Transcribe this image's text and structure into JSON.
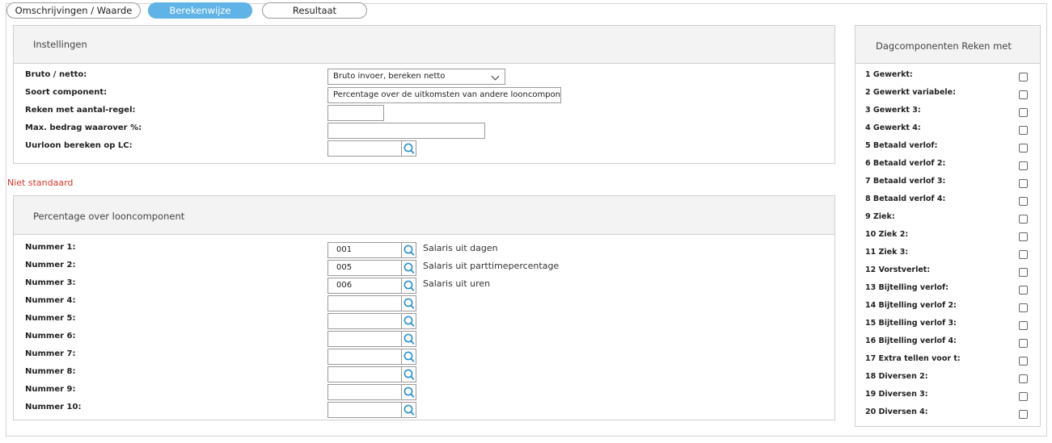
{
  "tabs": [
    {
      "label": "Omschrijvingen / Waarde",
      "active": false
    },
    {
      "label": "Berekenwijze",
      "active": true
    },
    {
      "label": "Resultaat",
      "active": false
    }
  ],
  "instellingen": {
    "title": "Instellingen",
    "bruto_netto_label": "Bruto / netto:",
    "bruto_netto_value": "Bruto invoer, bereken netto",
    "soort_label": "Soort component:",
    "soort_value": "Percentage over de uitkomsten van andere looncomponenten",
    "reken_label": "Reken met aantal-regel:",
    "reken_value": "",
    "max_label": "Max. bedrag waarover %:",
    "max_value": "",
    "uurloon_label": "Uurloon bereken op LC:",
    "uurloon_value": ""
  },
  "niet_standaard": "Niet standaard",
  "percentage": {
    "title": "Percentage over looncomponent",
    "rows": [
      {
        "label": "Nummer 1:",
        "value": "001",
        "desc": "Salaris uit dagen"
      },
      {
        "label": "Nummer 2:",
        "value": "005",
        "desc": "Salaris uit parttimepercentage"
      },
      {
        "label": "Nummer 3:",
        "value": "006",
        "desc": "Salaris uit uren"
      },
      {
        "label": "Nummer 4:",
        "value": "",
        "desc": ""
      },
      {
        "label": "Nummer 5:",
        "value": "",
        "desc": ""
      },
      {
        "label": "Nummer 6:",
        "value": "",
        "desc": ""
      },
      {
        "label": "Nummer 7:",
        "value": "",
        "desc": ""
      },
      {
        "label": "Nummer 8:",
        "value": "",
        "desc": ""
      },
      {
        "label": "Nummer 9:",
        "value": "",
        "desc": ""
      },
      {
        "label": "Nummer 10:",
        "value": "",
        "desc": ""
      }
    ]
  },
  "dagcomponenten": {
    "title": "Dagcomponenten Reken met",
    "items": [
      {
        "label": "1 Gewerkt:",
        "checked": false
      },
      {
        "label": "2 Gewerkt variabele:",
        "checked": false
      },
      {
        "label": "3 Gewerkt 3:",
        "checked": false
      },
      {
        "label": "4 Gewerkt 4:",
        "checked": false
      },
      {
        "label": "5 Betaald verlof:",
        "checked": false
      },
      {
        "label": "6 Betaald verlof 2:",
        "checked": false
      },
      {
        "label": "7 Betaald verlof 3:",
        "checked": false
      },
      {
        "label": "8 Betaald verlof 4:",
        "checked": false
      },
      {
        "label": "9 Ziek:",
        "checked": false
      },
      {
        "label": "10 Ziek 2:",
        "checked": false
      },
      {
        "label": "11 Ziek 3:",
        "checked": false
      },
      {
        "label": "12 Vorstverlet:",
        "checked": false
      },
      {
        "label": "13 Bijtelling verlof:",
        "checked": false
      },
      {
        "label": "14 Bijtelling verlof 2:",
        "checked": false
      },
      {
        "label": "15 Bijtelling verlof 3:",
        "checked": false
      },
      {
        "label": "16 Bijtelling verlof 4:",
        "checked": false
      },
      {
        "label": "17 Extra tellen voor t:",
        "checked": false
      },
      {
        "label": "18 Diversen 2:",
        "checked": false
      },
      {
        "label": "19 Diversen 3:",
        "checked": false
      },
      {
        "label": "20 Diversen 4:",
        "checked": false
      }
    ]
  },
  "colors": {
    "accent": "#5fb3e6",
    "warning": "#d9342b",
    "icon": "#2a8fd0"
  }
}
